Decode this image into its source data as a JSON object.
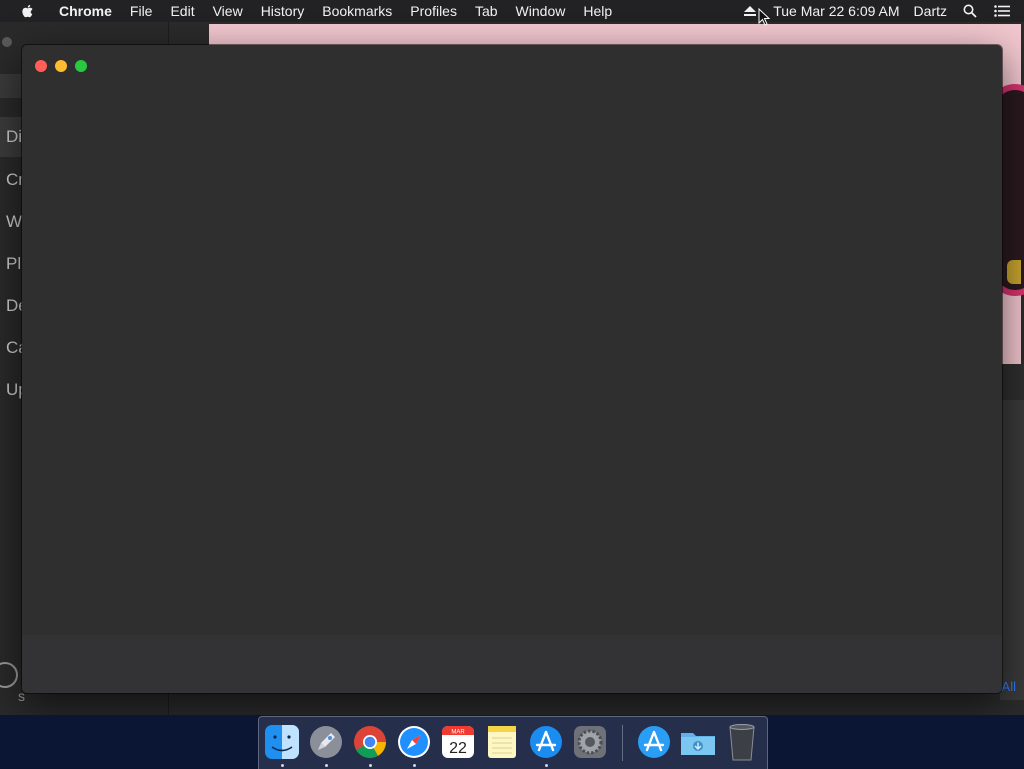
{
  "menubar": {
    "app_name": "Chrome",
    "menus": [
      "File",
      "Edit",
      "View",
      "History",
      "Bookmarks",
      "Profiles",
      "Tab",
      "Window",
      "Help"
    ],
    "datetime": "Tue Mar 22  6:09 AM",
    "user": "Dartz",
    "icons": [
      "apple-icon",
      "eject-icon",
      "spotlight-icon",
      "notification-center-icon"
    ]
  },
  "background_app": {
    "sidebar_items": [
      "Di",
      "Cr",
      "W",
      "Pl",
      "De",
      "Ca",
      "Up"
    ],
    "footer_letter": "s",
    "link_text": "All"
  },
  "window": {
    "controls": [
      "close",
      "minimize",
      "maximize"
    ],
    "colors": {
      "close": "#ff5f57",
      "minimize": "#febc2e",
      "maximize": "#28c840"
    }
  },
  "dock": {
    "calendar_month": "MAR",
    "calendar_day": "22",
    "items": [
      {
        "name": "Finder",
        "icon": "finder-icon",
        "running": true
      },
      {
        "name": "Launchpad",
        "icon": "launchpad-icon",
        "running": true
      },
      {
        "name": "Google Chrome",
        "icon": "chrome-icon",
        "running": true
      },
      {
        "name": "Safari",
        "icon": "safari-icon",
        "running": true
      },
      {
        "name": "Calendar",
        "icon": "calendar-icon",
        "running": false
      },
      {
        "name": "Notes",
        "icon": "notes-icon",
        "running": false
      },
      {
        "name": "App Store",
        "icon": "app-store-icon",
        "running": true
      },
      {
        "name": "System Preferences",
        "icon": "system-preferences-icon",
        "running": false
      },
      {
        "name": "Applications",
        "icon": "applications-folder-icon",
        "running": false
      },
      {
        "name": "Downloads",
        "icon": "downloads-folder-icon",
        "running": false
      },
      {
        "name": "Trash",
        "icon": "trash-icon",
        "running": false
      }
    ]
  }
}
